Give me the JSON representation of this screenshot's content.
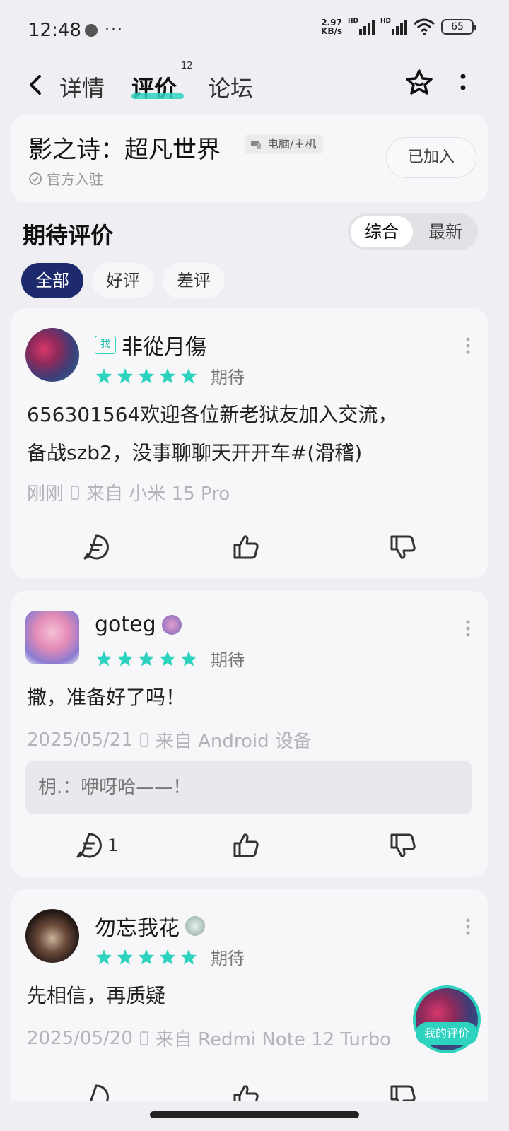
{
  "status_bar": {
    "time": "12:48",
    "more": "···",
    "speed_value": "2.97",
    "speed_unit": "KB/s",
    "hd": "HD",
    "battery": "65"
  },
  "nav": {
    "tabs": [
      {
        "label": "详情"
      },
      {
        "label": "评价",
        "badge": "12"
      },
      {
        "label": "论坛"
      }
    ]
  },
  "game": {
    "title": "影之诗：超凡世界",
    "platform": "电脑/主机",
    "official": "官方入驻",
    "joined_label": "已加入"
  },
  "section": {
    "title": "期待评价",
    "sort_options": [
      "综合",
      "最新"
    ],
    "filters": [
      "全部",
      "好评",
      "差评"
    ]
  },
  "reviews": [
    {
      "me_badge": "我",
      "username": "非從月傷",
      "rating": 5,
      "rating_label": "期待",
      "content_lines": [
        "656301564欢迎各位新老狱友加入交流，",
        "备战szb2，没事聊聊天开开车#(滑稽)"
      ],
      "time": "刚刚",
      "source": "来自 小米 15 Pro",
      "comment_count": ""
    },
    {
      "username": "goteg",
      "rating": 5,
      "rating_label": "期待",
      "content_lines": [
        "撒，准备好了吗！"
      ],
      "time": "2025/05/21",
      "source": "来自 Android 设备",
      "reply": "枂.：咿呀哈——！",
      "comment_count": "1"
    },
    {
      "username": "勿忘我花",
      "rating": 5,
      "rating_label": "期待",
      "content_lines": [
        "先相信，再质疑"
      ],
      "time": "2025/05/20",
      "source": "来自 Redmi Note 12 Turbo"
    }
  ],
  "fab": {
    "label": "我的评价"
  },
  "colors": {
    "accent": "#2ed3c0",
    "chip_active": "#1e2a6e",
    "star": "#2ed3c0"
  }
}
